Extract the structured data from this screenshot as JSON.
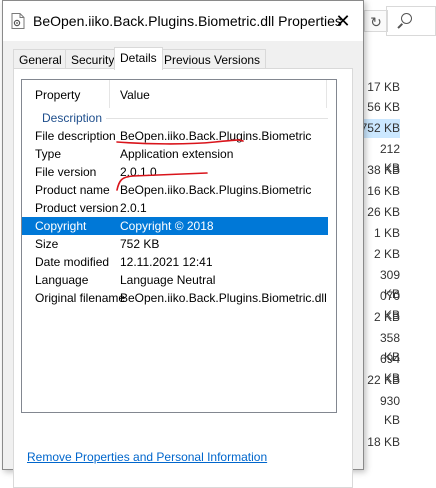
{
  "background": {
    "sizes": [
      "17 KB",
      "56 KB",
      "752 KB",
      "212 KB",
      "38 KB",
      "16 KB",
      "26 KB",
      "1 KB",
      "2 KB",
      "309 KB",
      "070 KB",
      "2 KB",
      "358 KB",
      "694 KB",
      "22 KB",
      "930 KB",
      "18 KB"
    ],
    "refresh_icon": "refresh-icon",
    "search_icon": "search-icon"
  },
  "dialog": {
    "title": "BeOpen.iiko.Back.Plugins.Biometric.dll Properties",
    "close_glyph": "✕",
    "tabs": [
      "General",
      "Security",
      "Details",
      "Previous Versions"
    ],
    "active_tab": "Details",
    "columns": {
      "property": "Property",
      "value": "Value"
    },
    "group": "Description",
    "rows": [
      {
        "property": "File description",
        "value": "BeOpen.iiko.Back.Plugins.Biometric"
      },
      {
        "property": "Type",
        "value": "Application extension"
      },
      {
        "property": "File version",
        "value": "2.0.1.0"
      },
      {
        "property": "Product name",
        "value": "BeOpen.iiko.Back.Plugins.Biometric"
      },
      {
        "property": "Product version",
        "value": "2.0.1"
      },
      {
        "property": "Copyright",
        "value": "Copyright ©  2018"
      },
      {
        "property": "Size",
        "value": "752 KB"
      },
      {
        "property": "Date modified",
        "value": "12.11.2021 12:41"
      },
      {
        "property": "Language",
        "value": "Language Neutral"
      },
      {
        "property": "Original filename",
        "value": "BeOpen.iiko.Back.Plugins.Biometric.dll"
      }
    ],
    "selected_row": "Copyright",
    "remove_link": "Remove Properties and Personal Information",
    "colors": {
      "selection": "#0078d7",
      "group_text": "#1e4e8c",
      "link": "#0066cc",
      "annotation": "#d9141b"
    }
  }
}
